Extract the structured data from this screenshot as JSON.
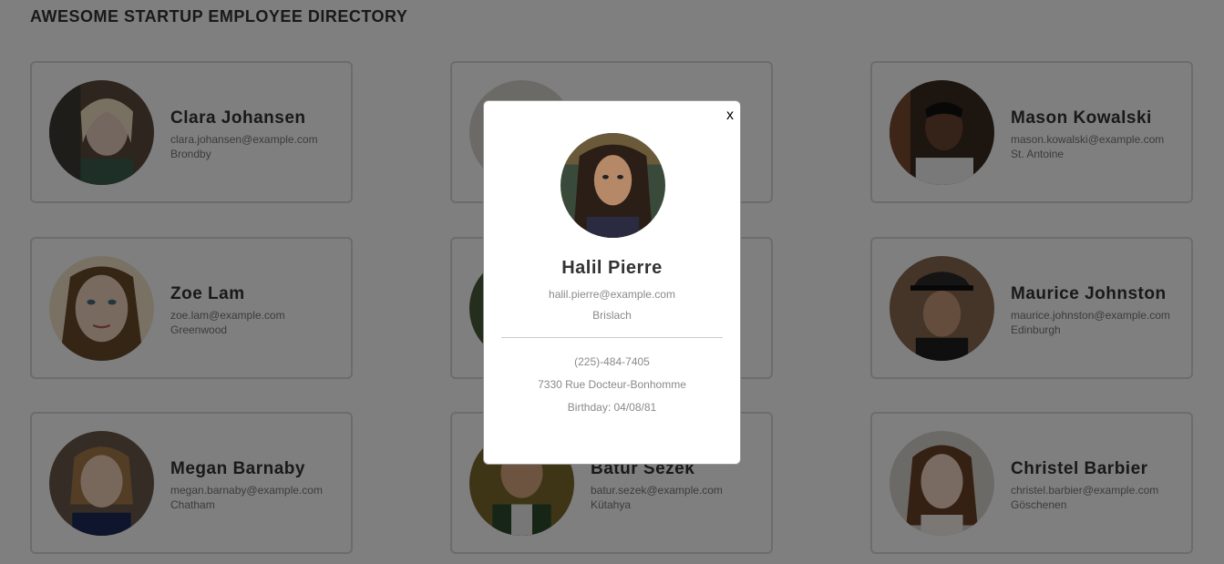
{
  "page": {
    "title": "AWESOME STARTUP EMPLOYEE DIRECTORY"
  },
  "employees": [
    {
      "name": "Clara Johansen",
      "email": "clara.johansen@example.com",
      "city": "Brondby"
    },
    {
      "name": "",
      "email": "",
      "city": ""
    },
    {
      "name": "Mason Kowalski",
      "email": "mason.kowalski@example.com",
      "city": "St. Antoine"
    },
    {
      "name": "Zoe Lam",
      "email": "zoe.lam@example.com",
      "city": "Greenwood"
    },
    {
      "name": "",
      "email": "",
      "city": ""
    },
    {
      "name": "Maurice Johnston",
      "email": "maurice.johnston@example.com",
      "city": "Edinburgh"
    },
    {
      "name": "Megan Barnaby",
      "email": "megan.barnaby@example.com",
      "city": "Chatham"
    },
    {
      "name": "Batur Sezek",
      "email": "batur.sezek@example.com",
      "city": "Kütahya"
    },
    {
      "name": "Christel Barbier",
      "email": "christel.barbier@example.com",
      "city": "Göschenen"
    }
  ],
  "modal": {
    "close_label": "x",
    "name": "Halil Pierre",
    "email": "halil.pierre@example.com",
    "city": "Brislach",
    "phone": "(225)-484-7405",
    "address": "7330 Rue Docteur-Bonhomme",
    "birthday": "Birthday: 04/08/81"
  },
  "colors": {
    "overlay": "#000000",
    "card_border": "#d8d8d8",
    "text_primary": "#333333",
    "text_secondary": "#777777"
  }
}
